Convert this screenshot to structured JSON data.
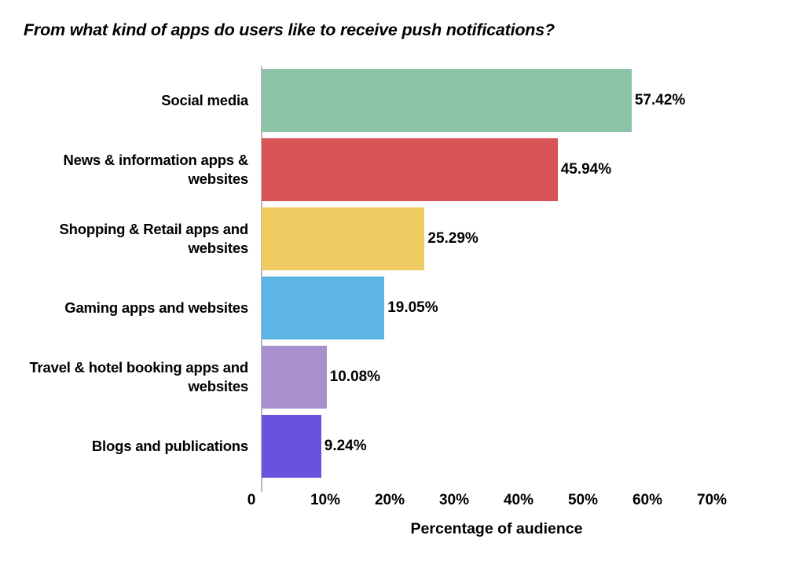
{
  "chart_data": {
    "type": "bar",
    "orientation": "horizontal",
    "title": "From what kind of apps do users like to receive push notifications?",
    "xlabel": "Percentage of audience",
    "ylabel": "",
    "categories": [
      "Social media",
      "News & information apps & websites",
      "Shopping & Retail apps and websites",
      "Gaming apps and websites",
      "Travel & hotel booking apps and websites",
      "Blogs and publications"
    ],
    "values": [
      57.42,
      45.94,
      25.29,
      19.05,
      10.08,
      9.24
    ],
    "value_labels": [
      "57.42%",
      "45.94%",
      "25.29%",
      "19.05%",
      "10.08%",
      "9.24%"
    ],
    "colors": [
      "#8cc3a7",
      "#d75457",
      "#efcb62",
      "#5cb5e4",
      "#a98fce",
      "#6a52dc"
    ],
    "xlim": [
      0,
      70
    ],
    "xticks": [
      0,
      10,
      20,
      30,
      40,
      50,
      60,
      70
    ],
    "xtick_labels": [
      "0",
      "10%",
      "20%",
      "30%",
      "40%",
      "50%",
      "60%",
      "70%"
    ],
    "grid": false,
    "legend": false
  }
}
